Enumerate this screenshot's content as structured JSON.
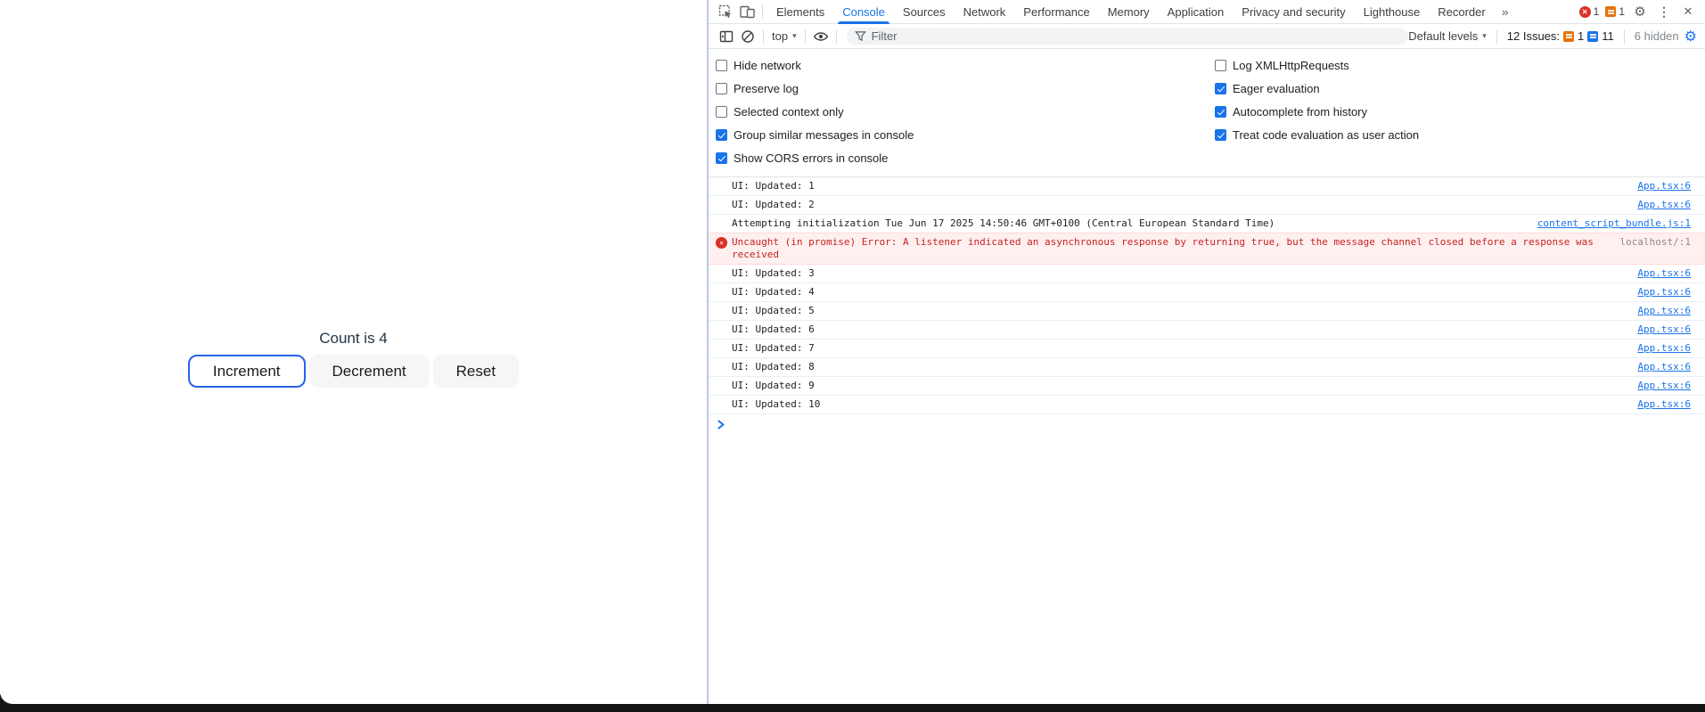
{
  "app": {
    "count_label": "Count is 4",
    "increment_label": "Increment",
    "decrement_label": "Decrement",
    "reset_label": "Reset"
  },
  "devtools": {
    "tabs": [
      "Elements",
      "Console",
      "Sources",
      "Network",
      "Performance",
      "Memory",
      "Application",
      "Privacy and security",
      "Lighthouse",
      "Recorder"
    ],
    "more_tabs_glyph": "»",
    "tabbar": {
      "error_count": "1",
      "issue_count": "1",
      "gear_glyph": "⚙",
      "dots_glyph": "⋮",
      "close_glyph": "✕"
    },
    "toolbar": {
      "context_selector": "top",
      "caret_glyph": "▾",
      "filter_placeholder": "Filter",
      "levels_label": "Default levels",
      "issues_label": "12 Issues:",
      "issues_warn_count": "1",
      "issues_info_count": "11",
      "hidden_label": "6 hidden",
      "settings_gear_glyph": "⚙"
    },
    "settings": {
      "left": [
        {
          "label": "Hide network",
          "checked": false
        },
        {
          "label": "Preserve log",
          "checked": false
        },
        {
          "label": "Selected context only",
          "checked": false
        },
        {
          "label": "Group similar messages in console",
          "checked": true
        },
        {
          "label": "Show CORS errors in console",
          "checked": true
        }
      ],
      "right": [
        {
          "label": "Log XMLHttpRequests",
          "checked": false
        },
        {
          "label": "Eager evaluation",
          "checked": true
        },
        {
          "label": "Autocomplete from history",
          "checked": true
        },
        {
          "label": "Treat code evaluation as user action",
          "checked": true
        }
      ]
    },
    "messages": [
      {
        "type": "log",
        "text": "UI: Updated: 1",
        "source": "App.tsx:6"
      },
      {
        "type": "log",
        "text": "UI: Updated: 2",
        "source": "App.tsx:6"
      },
      {
        "type": "log",
        "text": "Attempting initialization Tue Jun 17 2025 14:50:46 GMT+0100 (Central European Standard Time)",
        "source": "content_script_bundle.js:1"
      },
      {
        "type": "error",
        "text": "Uncaught (in promise) Error: A listener indicated an asynchronous response by returning true, but the message channel closed before a response was received",
        "source": "localhost/:1"
      },
      {
        "type": "log",
        "text": "UI: Updated: 3",
        "source": "App.tsx:6"
      },
      {
        "type": "log",
        "text": "UI: Updated: 4",
        "source": "App.tsx:6"
      },
      {
        "type": "log",
        "text": "UI: Updated: 5",
        "source": "App.tsx:6"
      },
      {
        "type": "log",
        "text": "UI: Updated: 6",
        "source": "App.tsx:6"
      },
      {
        "type": "log",
        "text": "UI: Updated: 7",
        "source": "App.tsx:6"
      },
      {
        "type": "log",
        "text": "UI: Updated: 8",
        "source": "App.tsx:6"
      },
      {
        "type": "log",
        "text": "UI: Updated: 9",
        "source": "App.tsx:6"
      },
      {
        "type": "log",
        "text": "UI: Updated: 10",
        "source": "App.tsx:6"
      }
    ]
  },
  "colors": {
    "accent_blue": "#1a73e8",
    "error_red": "#d93025",
    "error_bg": "#fff0f0",
    "issue_orange": "#e8710a",
    "focus_border_blue": "#2563eb"
  }
}
